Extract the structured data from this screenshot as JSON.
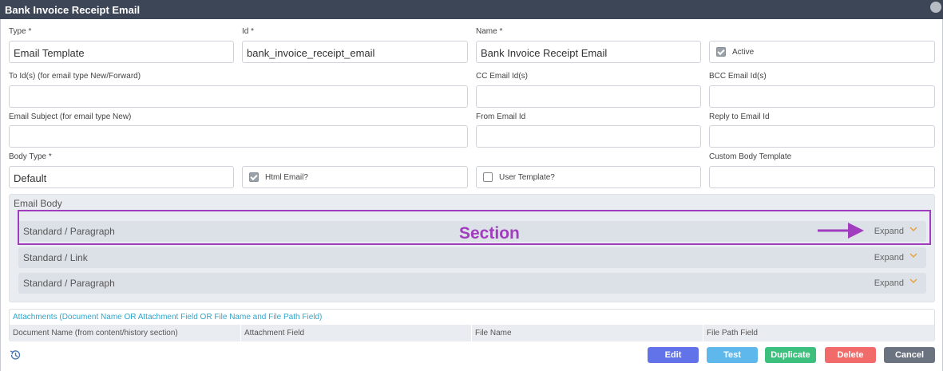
{
  "window": {
    "title": "Bank Invoice Receipt Email"
  },
  "form": {
    "type": {
      "label": "Type *",
      "value": "Email Template"
    },
    "id": {
      "label": "Id *",
      "value": "bank_invoice_receipt_email"
    },
    "name": {
      "label": "Name *",
      "value": "Bank Invoice Receipt Email"
    },
    "active": {
      "label": "Active",
      "checked": true
    },
    "to_ids": {
      "label": "To Id(s) (for email type New/Forward)",
      "value": ""
    },
    "cc_ids": {
      "label": "CC Email Id(s)",
      "value": ""
    },
    "bcc_ids": {
      "label": "BCC Email Id(s)",
      "value": ""
    },
    "subject": {
      "label": "Email Subject (for email type New)",
      "value": ""
    },
    "from": {
      "label": "From Email Id",
      "value": ""
    },
    "reply_to": {
      "label": "Reply to Email Id",
      "value": ""
    },
    "body_type": {
      "label": "Body Type *",
      "value": "Default"
    },
    "html_email": {
      "label": "Html Email?",
      "checked": true
    },
    "user_template": {
      "label": "User Template?",
      "checked": false
    },
    "custom_body_template": {
      "label": "Custom Body Template",
      "value": ""
    }
  },
  "email_body": {
    "title": "Email Body",
    "sections": [
      {
        "label": "Standard / Paragraph",
        "expand": "Expand"
      },
      {
        "label": "Standard / Link",
        "expand": "Expand"
      },
      {
        "label": "Standard / Paragraph",
        "expand": "Expand"
      }
    ]
  },
  "annotation": {
    "text": "Section",
    "color": "#a03cbd"
  },
  "attachments": {
    "title": "Attachments (Document Name OR Attachment Field OR File Name and File Path Field)",
    "columns": [
      "Document Name (from content/history section)",
      "Attachment Field",
      "File Name",
      "File Path Field"
    ]
  },
  "footer": {
    "history_icon": "history-icon",
    "buttons": [
      {
        "label": "Edit",
        "color": "#6272e8"
      },
      {
        "label": "Test",
        "color": "#5eb8ec"
      },
      {
        "label": "Duplicate",
        "color": "#3dc07d"
      },
      {
        "label": "Delete",
        "color": "#f26b6b"
      },
      {
        "label": "Cancel",
        "color": "#6b7280"
      }
    ]
  }
}
